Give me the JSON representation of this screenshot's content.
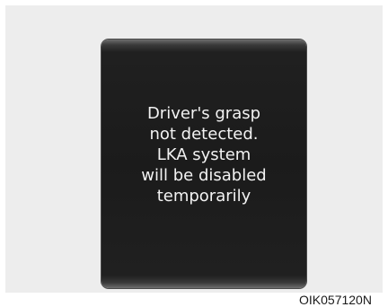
{
  "display": {
    "message_lines": [
      "Driver's grasp",
      "not detected.",
      "LKA system",
      "will be disabled",
      "temporarily"
    ]
  },
  "figure_code": "OIK057120N"
}
